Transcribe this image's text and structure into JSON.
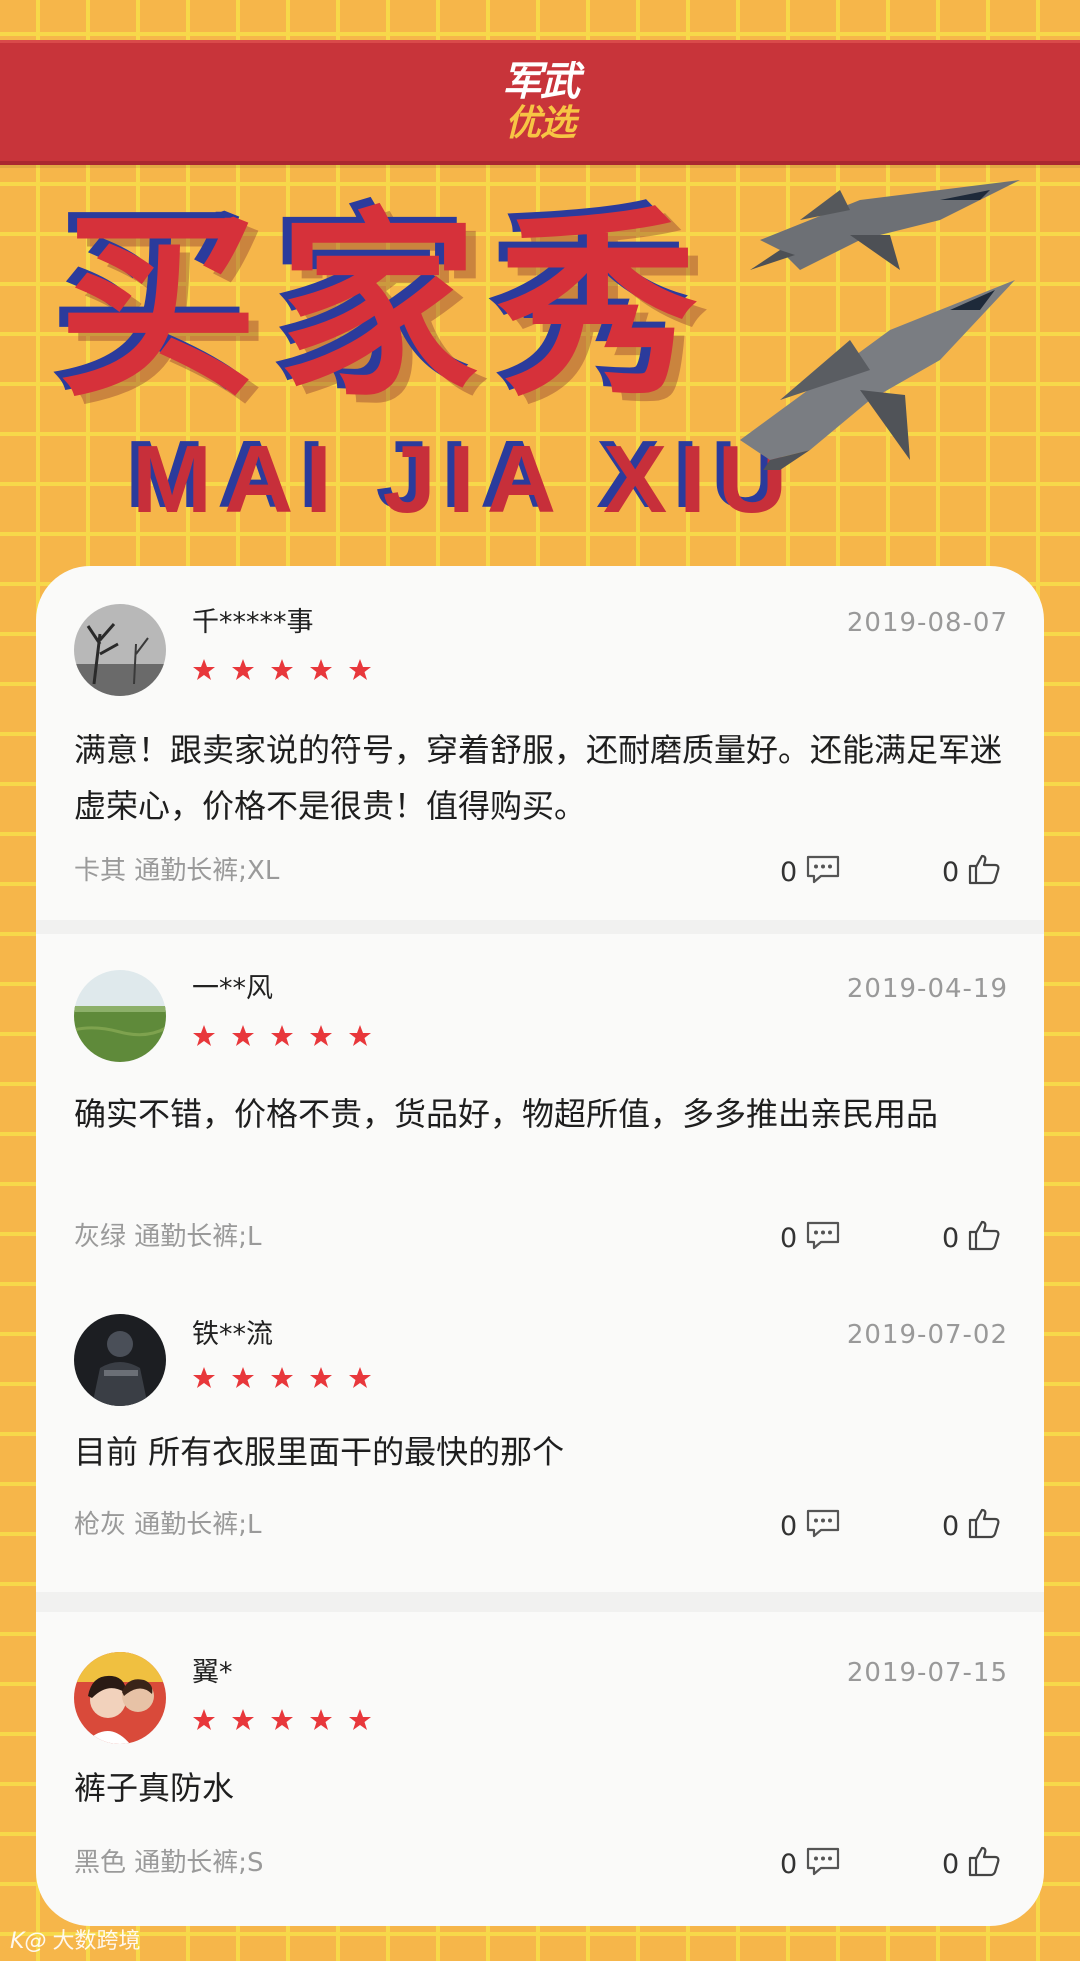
{
  "header": {
    "logo_top": "军武",
    "logo_bottom": "优选"
  },
  "hero": {
    "title": "买家秀",
    "subtitle": "MAI JIA XIU"
  },
  "reviews": [
    {
      "username": "千*****事",
      "date": "2019-08-07",
      "rating": 5,
      "comment": "满意！跟卖家说的符号，穿着舒服，还耐磨质量好。还能满足军迷虚荣心，价格不是很贵！值得购买。",
      "variant": "卡其 通勤长裤;XL",
      "comment_count": "0",
      "like_count": "0",
      "avatar": "tree-photo"
    },
    {
      "username": "一**风",
      "date": "2019-04-19",
      "rating": 5,
      "comment": "确实不错，价格不贵，货品好，物超所值，多多推出亲民用品",
      "variant": "灰绿 通勤长裤;L",
      "comment_count": "0",
      "like_count": "0",
      "avatar": "grass-field-photo"
    },
    {
      "username": "铁**流",
      "date": "2019-07-02",
      "rating": 5,
      "comment": "目前 所有衣服里面干的最快的那个",
      "variant": "枪灰 通勤长裤;L",
      "comment_count": "0",
      "like_count": "0",
      "avatar": "soldier-photo"
    },
    {
      "username": "翼*",
      "date": "2019-07-15",
      "rating": 5,
      "comment": "裤子真防水",
      "variant": "黑色 通勤长裤;S",
      "comment_count": "0",
      "like_count": "0",
      "avatar": "couple-photo"
    }
  ],
  "watermark": {
    "logo": "K@",
    "text": "大数跨境"
  },
  "colors": {
    "background": "#f6b64a",
    "grid": "#f7d84a",
    "header_red": "#c8343a",
    "star_red": "#e8373b",
    "title_red": "#d6313a",
    "title_shadow_blue": "#2b3b9c"
  },
  "icons": [
    "comment-icon",
    "thumbs-up-icon",
    "star-icon"
  ]
}
